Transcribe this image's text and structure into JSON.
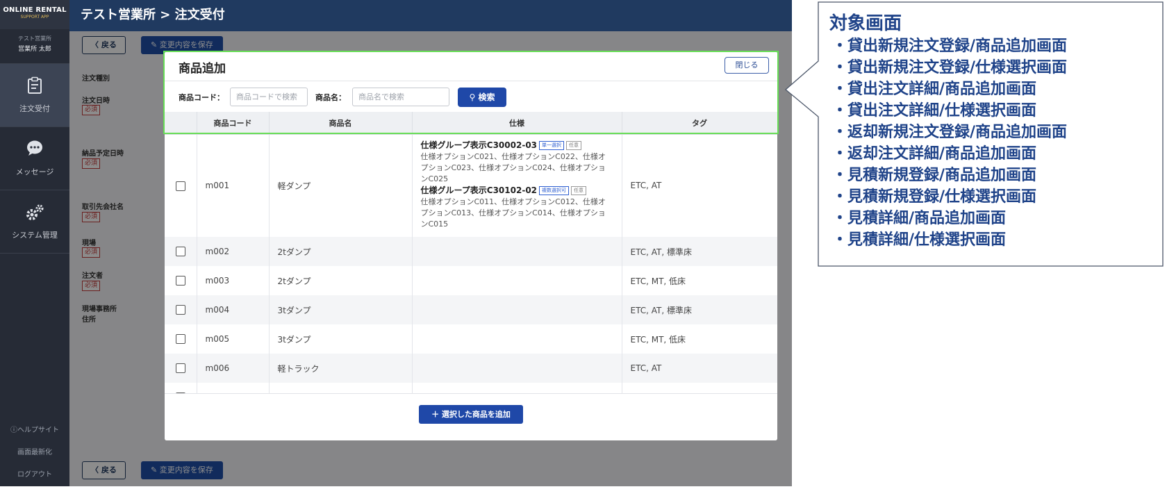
{
  "app": {
    "logo_line1": "ONLINE RENTAL",
    "logo_line2": "SUPPORT APP",
    "user_office": "テスト営業所",
    "user_name": "営業所 太郎",
    "nav": [
      {
        "label": "注文受付",
        "icon": "clipboard-icon"
      },
      {
        "label": "メッセージ",
        "icon": "chat-bubble-icon"
      },
      {
        "label": "システム管理",
        "icon": "gears-icon"
      }
    ],
    "help": "ヘルプサイト",
    "refresh": "画面最新化",
    "logout": "ログアウト",
    "breadcrumb": "テスト営業所 > 注文受付",
    "back_label": "戻る",
    "save_label": "変更内容を保存",
    "fields": [
      "注文種別",
      "注文日時",
      "納品予定日時",
      "取引先会社名",
      "現場",
      "注文者",
      "現場事務所",
      "住所"
    ],
    "required": "必須"
  },
  "modal": {
    "title": "商品追加",
    "close": "閉じる",
    "code_label": "商品コード：",
    "code_placeholder": "商品コードで検索",
    "name_label": "商品名：",
    "name_placeholder": "商品名で検索",
    "search": "検索",
    "headers": [
      "商品コード",
      "商品名",
      "仕様",
      "タグ"
    ],
    "row1": {
      "code": "m001",
      "name": "軽ダンプ",
      "group1": "仕様グループ表示C30002-03",
      "g1tag1": "単一選択",
      "g1tag2": "任意",
      "g1opts": "仕様オプションC021、仕様オプションC022、仕様オプションC023、仕様オプションC024、仕様オプションC025",
      "group2": "仕様グループ表示C30102-02",
      "g2tag1": "複数選択可",
      "g2tag2": "任意",
      "g2opts": "仕様オプションC011、仕様オプションC012、仕様オプションC013、仕様オプションC014、仕様オプションC015",
      "tags": "ETC, AT"
    },
    "rows": [
      {
        "code": "m002",
        "name": "2tダンプ",
        "tags": "ETC, AT, 標準床"
      },
      {
        "code": "m003",
        "name": "2tダンプ",
        "tags": "ETC, MT, 低床"
      },
      {
        "code": "m004",
        "name": "3tダンプ",
        "tags": "ETC, AT, 標準床"
      },
      {
        "code": "m005",
        "name": "3tダンプ",
        "tags": "ETC, MT, 低床"
      },
      {
        "code": "m006",
        "name": "軽トラック",
        "tags": "ETC, AT"
      }
    ],
    "add_selected": "＋ 選択した商品を追加"
  },
  "callout": {
    "title": "対象画面",
    "items": [
      "・貸出新規注文登録/商品追加画面",
      "・貸出新規注文登録/仕様選択画面",
      "・貸出注文詳細/商品追加画面",
      "・貸出注文詳細/仕様選択画面",
      "・返却新規注文登録/商品追加画面",
      "・返却注文詳細/商品追加画面",
      "・見積新規登録/商品追加画面",
      "・見積新規登録/仕様選択画面",
      "・見積詳細/商品追加画面",
      "・見積詳細/仕様選択画面"
    ]
  }
}
